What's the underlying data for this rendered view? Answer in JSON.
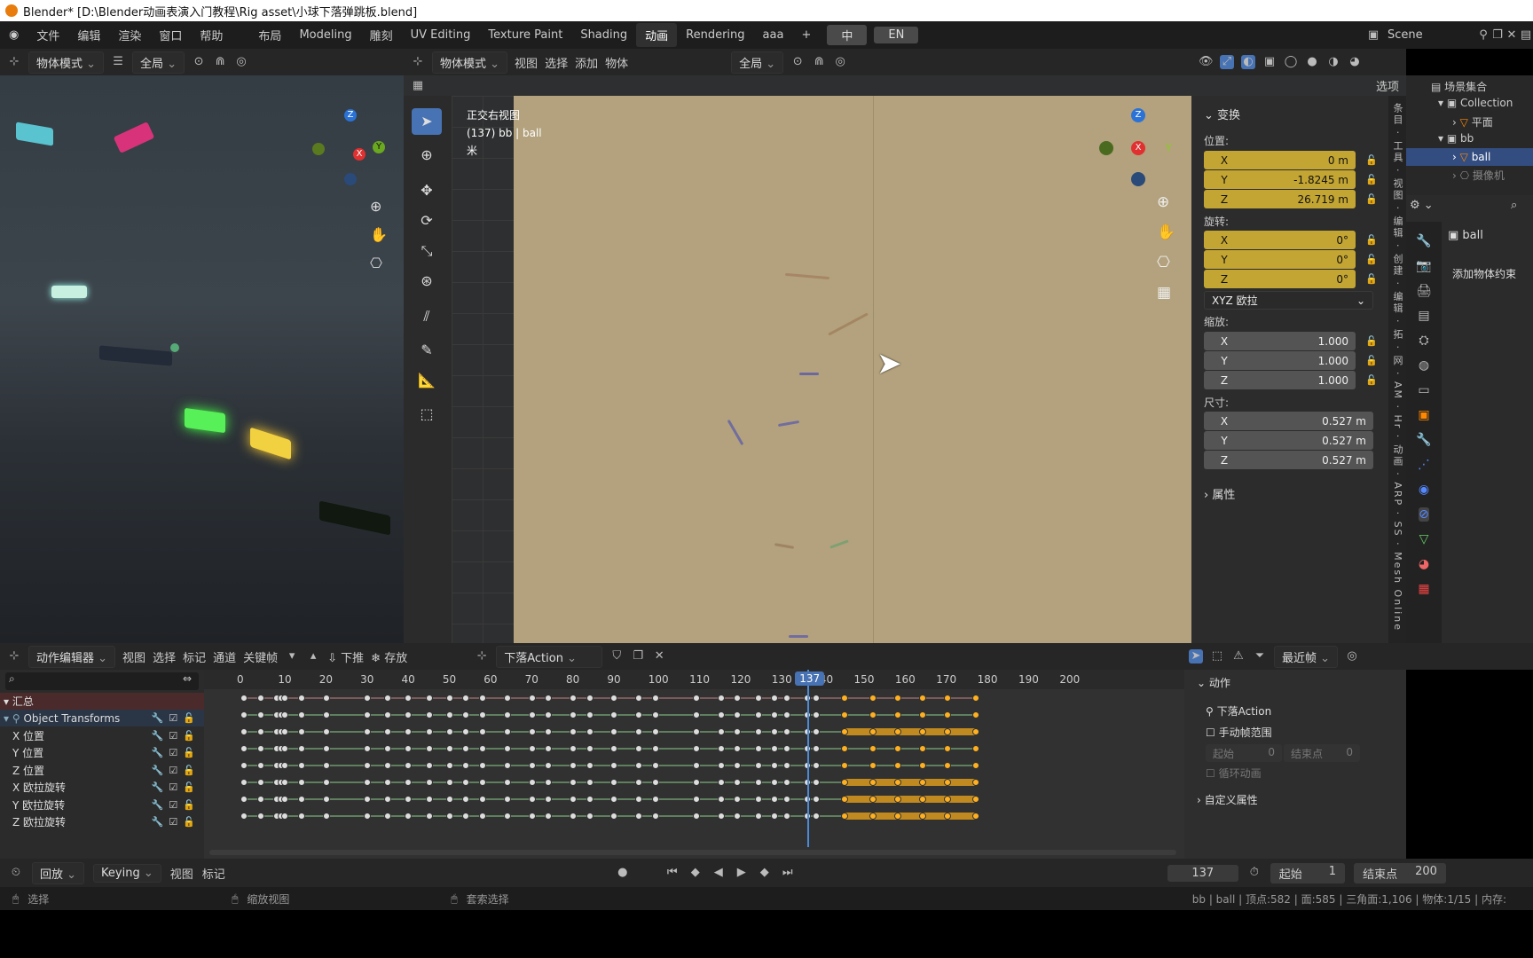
{
  "window": {
    "title": "Blender* [D:\\Blender动画表演入门教程\\Rig asset\\小球下落弹跳板.blend]"
  },
  "menu": [
    "文件",
    "编辑",
    "渲染",
    "窗口",
    "帮助"
  ],
  "workspaces": [
    {
      "label": "布局",
      "active": false
    },
    {
      "label": "Modeling",
      "active": false
    },
    {
      "label": "雕刻",
      "active": false
    },
    {
      "label": "UV Editing",
      "active": false
    },
    {
      "label": "Texture Paint",
      "active": false
    },
    {
      "label": "Shading",
      "active": false
    },
    {
      "label": "动画",
      "active": true
    },
    {
      "label": "Rendering",
      "active": false
    },
    {
      "label": "aaa",
      "active": false
    }
  ],
  "topbar_buttons": {
    "zh": "中",
    "en": "EN"
  },
  "scene": {
    "label": "Scene"
  },
  "left_view": {
    "mode": "物体模式",
    "transform": "全局",
    "options": "选项"
  },
  "main_view": {
    "mode": "物体模式",
    "menus": [
      "视图",
      "选择",
      "添加",
      "物体"
    ],
    "transform": "全局",
    "options": "选项",
    "overlay_title": "正交右视图",
    "overlay_sub": "(137) bb | ball",
    "overlay_unit": "米"
  },
  "npanel": {
    "transform_header": "变换",
    "location_label": "位置:",
    "location": [
      {
        "axis": "X",
        "value": "0 m"
      },
      {
        "axis": "Y",
        "value": "-1.8245 m"
      },
      {
        "axis": "Z",
        "value": "26.719 m"
      }
    ],
    "rotation_label": "旋转:",
    "rotation": [
      {
        "axis": "X",
        "value": "0°"
      },
      {
        "axis": "Y",
        "value": "0°"
      },
      {
        "axis": "Z",
        "value": "0°"
      }
    ],
    "rotation_mode": "XYZ 欧拉",
    "scale_label": "缩放:",
    "scale": [
      {
        "axis": "X",
        "value": "1.000"
      },
      {
        "axis": "Y",
        "value": "1.000"
      },
      {
        "axis": "Z",
        "value": "1.000"
      }
    ],
    "dimensions_label": "尺寸:",
    "dimensions": [
      {
        "axis": "X",
        "value": "0.527 m"
      },
      {
        "axis": "Y",
        "value": "0.527 m"
      },
      {
        "axis": "Z",
        "value": "0.527 m"
      }
    ],
    "properties_header": "属性",
    "tabs": [
      "条目",
      "工具",
      "视图",
      "编辑",
      "创建",
      "编辑",
      "拓",
      "网",
      "AM",
      "Hr",
      "动画",
      "ARP",
      "SS",
      "Mesh Online"
    ]
  },
  "outliner": {
    "root": "场景集合",
    "items": [
      {
        "label": "Collection"
      },
      {
        "label": "平面"
      },
      {
        "label": "bb"
      },
      {
        "label": "ball",
        "selected": true
      },
      {
        "label": "摄像机"
      }
    ]
  },
  "properties": {
    "object": "ball",
    "add_constraint": "添加物体约束"
  },
  "dopesheet": {
    "editor": "动作编辑器",
    "menus": [
      "视图",
      "选择",
      "标记",
      "通道",
      "关键帧"
    ],
    "push_down": "下推",
    "stash": "存放",
    "action": "下落Action",
    "snap": "最近帧",
    "channels": [
      {
        "label": "汇总"
      },
      {
        "label": "Object Transforms"
      },
      {
        "label": "X 位置"
      },
      {
        "label": "Y 位置"
      },
      {
        "label": "Z 位置"
      },
      {
        "label": "X 欧拉旋转"
      },
      {
        "label": "Y 欧拉旋转"
      },
      {
        "label": "Z 欧拉旋转"
      }
    ],
    "ruler": [
      "0",
      "10",
      "20",
      "30",
      "40",
      "50",
      "60",
      "70",
      "80",
      "90",
      "100",
      "110",
      "120",
      "130",
      "140",
      "150",
      "160",
      "170",
      "180",
      "190",
      "200"
    ],
    "current_frame": "137",
    "keyframes": [
      0,
      4,
      8,
      9,
      10,
      14,
      20,
      30,
      35,
      40,
      45,
      50,
      54,
      58,
      64,
      70,
      74,
      80,
      84,
      90,
      96,
      100,
      110,
      116,
      120,
      125,
      129,
      132,
      137,
      139,
      146,
      153,
      159,
      165,
      171,
      178
    ]
  },
  "action_panel": {
    "header": "动作",
    "action_name": "下落Action",
    "manual_range": "手动帧范围",
    "start_label": "起始",
    "start_value": "0",
    "end_label": "结束点",
    "end_value": "0",
    "cyclic": "循环动画",
    "custom_props": "自定义属性"
  },
  "timeline": {
    "playback": "回放",
    "keying": "Keying",
    "view": "视图",
    "marker": "标记",
    "current": "137",
    "start_label": "起始",
    "start": "1",
    "end_label": "结束点",
    "end": "200"
  },
  "status": {
    "select": "选择",
    "zoom": "缩放视图",
    "lasso": "套索选择",
    "stats": "bb | ball | 顶点:582 | 面:585 | 三角面:1,106 | 物体:1/15 | 内存:"
  },
  "colors": {
    "accent": "#4772b3",
    "anim_field": "#c3a533",
    "key_selected": "#ffb020",
    "camera_bg": "#b3a27d"
  }
}
